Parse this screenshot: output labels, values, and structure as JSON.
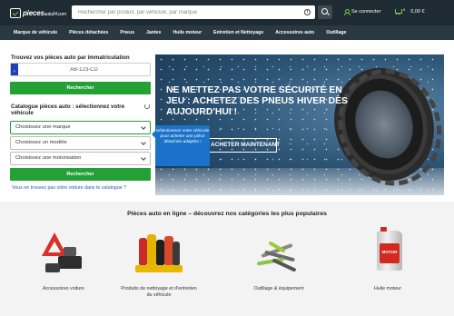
{
  "header": {
    "logo_text": "pieces",
    "logo_suffix": "auto24.com",
    "search_placeholder": "Rechercher par produit, par véhicule, par marque",
    "login_label": "Se connecter",
    "cart_count": "0",
    "cart_total": "0,00 €"
  },
  "nav": {
    "items": [
      "Marque de véhicule",
      "Pièces détachées",
      "Pneus",
      "Jantes",
      "Huile moteur",
      "Entretien et Nettoyage",
      "Accessoires auto",
      "Outillage"
    ]
  },
  "plate_search": {
    "title": "Trouvez vos pièces auto par immatriculation",
    "flag_text": "F",
    "plate_value": "AB-123-CD",
    "button_label": "Rechercher"
  },
  "catalog": {
    "title": "Catalogue pièces auto : sélectionnez votre véhicule",
    "select_brand": "Choisissez une marque",
    "select_model": "Choisissez un modèle",
    "select_engine": "Choisissez une motorisation",
    "button_label": "Rechercher",
    "missing_link": "Vous ne trouvez pas votre voiture dans le catalogue ?"
  },
  "tooltip": {
    "text": "Sélectionnez votre véhicule pour acheter une pièce détachée adaptée !"
  },
  "banner": {
    "headline": "NE METTEZ PAS VOTRE SÉCURITÉ EN JEU : ACHETEZ DES PNEUS HIVER DÈS AUJOURD'HUI !",
    "cta": "ACHETER MAINTENANT"
  },
  "categories": {
    "title": "Pièces auto en ligne – découvrez nos catégories les plus populaires",
    "items": [
      {
        "label": "Accessoires voiture",
        "icon": "warning-triangle-icon"
      },
      {
        "label": "Produits de nettoyage et d'entretien du véhicule",
        "icon": "cleaning-products-icon"
      },
      {
        "label": "Outillage & équipement",
        "icon": "tools-icon"
      },
      {
        "label": "Huile moteur",
        "icon": "motor-oil-can-icon",
        "can_text": "MOTOR"
      }
    ]
  },
  "colors": {
    "header_bg": "#1e2b32",
    "nav_bg": "#2a3940",
    "accent_green": "#23a036",
    "tooltip_blue": "#1a73c9",
    "link_blue": "#1d5fb0"
  }
}
